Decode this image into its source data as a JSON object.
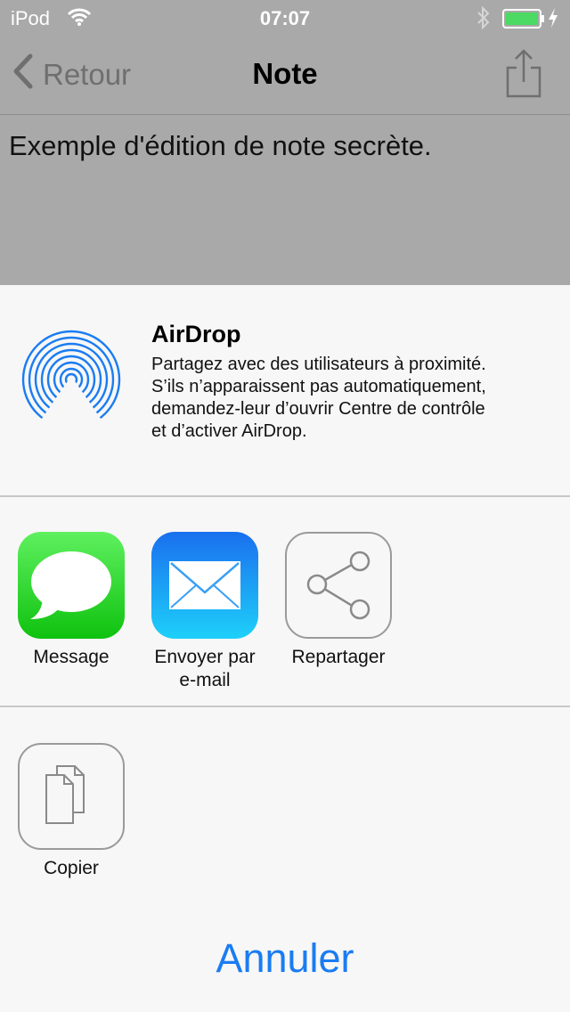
{
  "status_bar": {
    "carrier": "iPod",
    "time": "07:07",
    "icons": [
      "wifi-icon",
      "bluetooth-icon",
      "battery-icon",
      "charging-icon"
    ],
    "battery_color": "#4cd964"
  },
  "nav_bar": {
    "back_label": "Retour",
    "title": "Note",
    "share_icon": "share-icon"
  },
  "note": {
    "text": "Exemple d'édition de note secrète."
  },
  "share_sheet": {
    "airdrop": {
      "title": "AirDrop",
      "lines": [
        "Partagez avec des utilisateurs à proximité.",
        "S’ils n’apparaissent pas automatiquement,",
        "demandez-leur d’ouvrir Centre de contrôle",
        "et d’activer AirDrop."
      ],
      "icon": "airdrop-icon",
      "color": "#1a7cf2"
    },
    "actions": [
      {
        "label_lines": [
          "Message"
        ],
        "icon": "message-icon"
      },
      {
        "label_lines": [
          "Envoyer par",
          "e-mail"
        ],
        "icon": "mail-icon"
      },
      {
        "label_lines": [
          "Repartager"
        ],
        "icon": "reshare-icon"
      }
    ],
    "secondary_actions": [
      {
        "label_lines": [
          "Copier"
        ],
        "icon": "copy-icon"
      }
    ],
    "cancel_label": "Annuler",
    "accent_color": "#1a7cf2"
  }
}
